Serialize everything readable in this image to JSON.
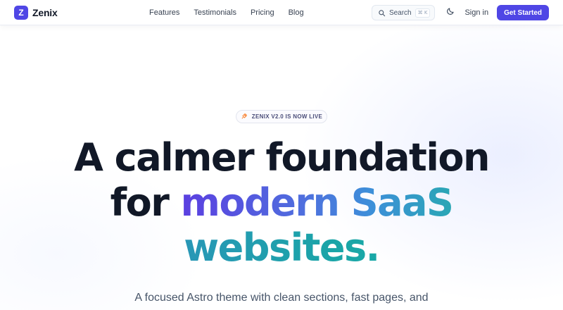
{
  "brand": {
    "logo_letter": "Z",
    "name": "Zenix",
    "accent": "#4f46e5"
  },
  "nav": {
    "links": [
      {
        "label": "Features"
      },
      {
        "label": "Testimonials"
      },
      {
        "label": "Pricing"
      },
      {
        "label": "Blog"
      }
    ],
    "search": {
      "label": "Search",
      "shortcut": "⌘ K",
      "icon": "search-icon"
    },
    "theme_toggle_icon": "moon-icon",
    "signin_label": "Sign in",
    "cta_label": "Get Started"
  },
  "hero": {
    "badge": {
      "icon": "rocket-icon",
      "text": "ZENIX V2.0 IS NOW LIVE"
    },
    "headline": {
      "line1": "A calmer foundation",
      "line2_plain": "for ",
      "line2_accent": "modern SaaS",
      "line3_accent": "websites."
    },
    "subtitle": "A focused Astro theme with clean sections, fast pages, and"
  }
}
